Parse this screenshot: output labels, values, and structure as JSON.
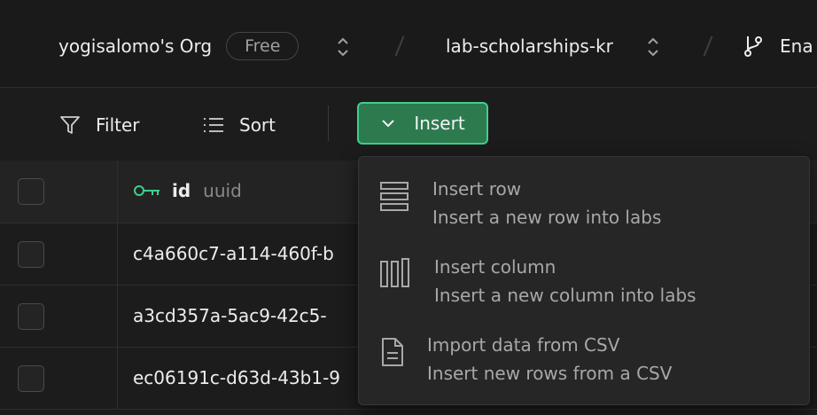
{
  "topbar": {
    "org_name": "yogisalomo's Org",
    "plan_badge": "Free",
    "project_name": "lab-scholarships-kr",
    "branch_label": "Ena"
  },
  "toolbar": {
    "filter_label": "Filter",
    "sort_label": "Sort",
    "insert_label": "Insert"
  },
  "table": {
    "columns": [
      {
        "name": "id",
        "type": "uuid",
        "icon": "key-icon"
      }
    ],
    "rows": [
      {
        "id": "c4a660c7-a114-460f-b"
      },
      {
        "id": "a3cd357a-5ac9-42c5-"
      },
      {
        "id": "ec06191c-d63d-43b1-9"
      }
    ]
  },
  "insert_menu": {
    "items": [
      {
        "title": "Insert row",
        "description": "Insert a new row into labs",
        "icon": "rows-icon"
      },
      {
        "title": "Insert column",
        "description": "Insert a new column into labs",
        "icon": "columns-icon"
      },
      {
        "title": "Import data from CSV",
        "description": "Insert new rows from a CSV",
        "icon": "file-icon"
      }
    ]
  },
  "colors": {
    "background": "#1c1c1c",
    "accent_green": "#3ecf8e",
    "insert_button_fill": "#2d7a4f"
  }
}
